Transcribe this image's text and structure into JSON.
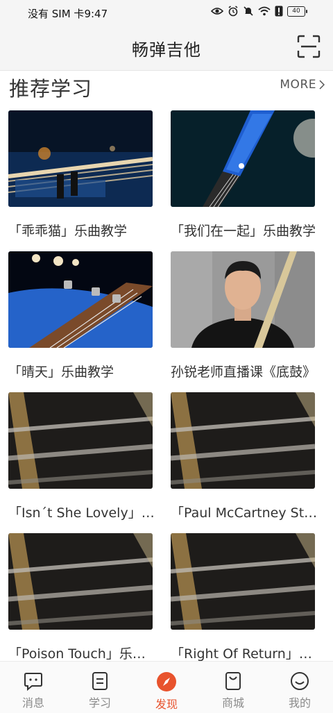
{
  "status": {
    "left_text": "没有 SIM 卡",
    "time": "9:47",
    "battery": "40"
  },
  "header": {
    "title": "畅弹吉他"
  },
  "section": {
    "title": "推荐学习",
    "more_label": "MORE"
  },
  "cards": [
    {
      "title": "「乖乖猫」乐曲教学"
    },
    {
      "title": "「我们在一起」乐曲教学"
    },
    {
      "title": "「晴天」乐曲教学"
    },
    {
      "title": "孙锐老师直播课《底鼓》"
    },
    {
      "title": "「Isn´t She Lovely」乐曲教学"
    },
    {
      "title": "「Paul McCartney Style」"
    },
    {
      "title": "「Poison Touch」乐曲教学"
    },
    {
      "title": "「Right Of Return」乐曲教学"
    }
  ],
  "tabs": [
    {
      "label": "消息",
      "icon": "message-icon",
      "active": false
    },
    {
      "label": "学习",
      "icon": "document-icon",
      "active": false
    },
    {
      "label": "发现",
      "icon": "compass-icon",
      "active": true
    },
    {
      "label": "商城",
      "icon": "shopping-bag-icon",
      "active": false
    },
    {
      "label": "我的",
      "icon": "smiley-icon",
      "active": false
    }
  ],
  "colors": {
    "accent": "#e8532d",
    "inactive": "#8a8a8a"
  }
}
